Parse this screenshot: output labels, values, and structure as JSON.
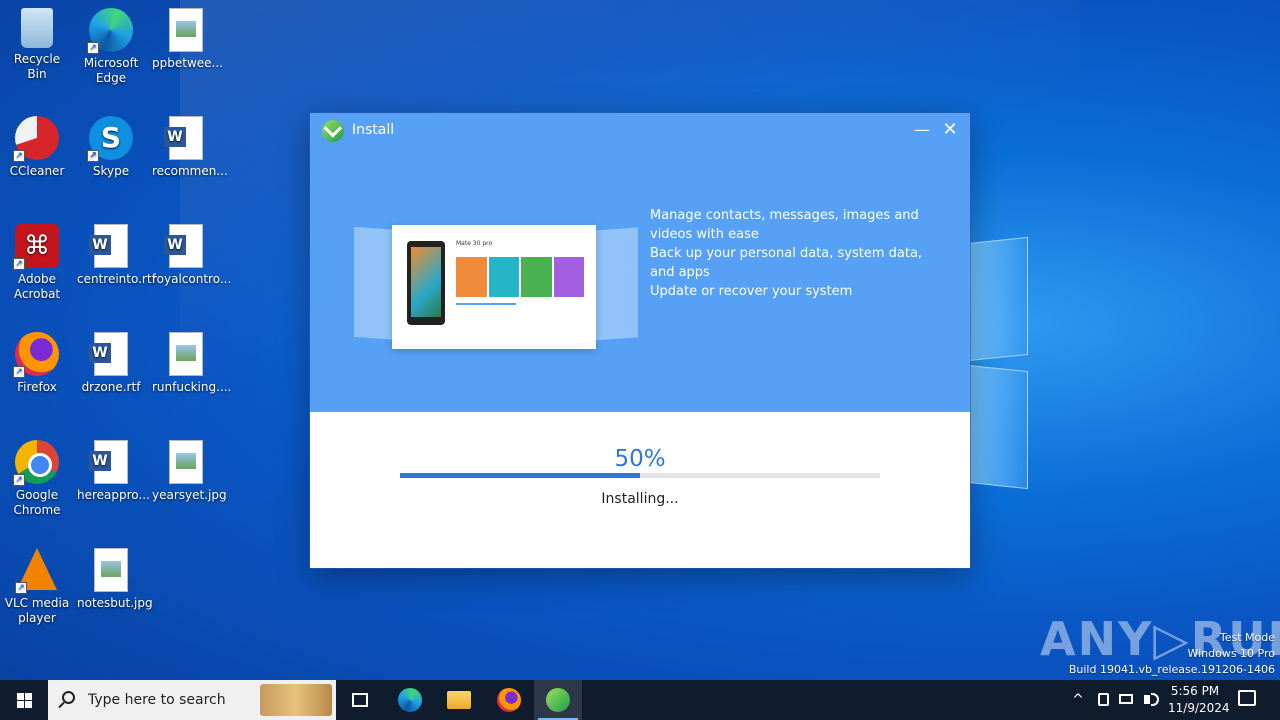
{
  "desktop": {
    "icons": [
      {
        "label": "Recycle Bin"
      },
      {
        "label": "Microsoft Edge"
      },
      {
        "label": "ppbetwee..."
      },
      {
        "label": "CCleaner"
      },
      {
        "label": "Skype"
      },
      {
        "label": "recommen..."
      },
      {
        "label": "Adobe Acrobat"
      },
      {
        "label": "centreinto.rtf"
      },
      {
        "label": "royalcontro..."
      },
      {
        "label": "Firefox"
      },
      {
        "label": "drzone.rtf"
      },
      {
        "label": "runfucking...."
      },
      {
        "label": "Google Chrome"
      },
      {
        "label": "hereappro..."
      },
      {
        "label": "yearsyet.jpg"
      },
      {
        "label": "VLC media player"
      },
      {
        "label": "notesbut.jpg"
      }
    ]
  },
  "installer": {
    "title": "Install",
    "minimize_glyph": "—",
    "close_glyph": "✕",
    "preview": {
      "device_title": "Mate 30 pro"
    },
    "features": [
      "Manage contacts, messages, images and videos with ease",
      "Back up your personal data, system data, and apps",
      "Update or recover your system"
    ],
    "progress": {
      "percent_label": "50%",
      "value": 0.5,
      "status": "Installing..."
    }
  },
  "watermark": {
    "brand": "ANY▷RUN",
    "mode": "Test Mode",
    "edition": "Windows 10 Pro",
    "build": "Build 19041.vb_release.191206-1406"
  },
  "taskbar": {
    "search_placeholder": "Type here to search",
    "apps": [
      "task-view",
      "edge",
      "file-explorer",
      "firefox",
      "hisuite-installer"
    ],
    "tray": {
      "chevron": "^",
      "time": "5:56 PM",
      "date": "11/9/2024"
    }
  },
  "colors": {
    "window_header": "#56a1f5",
    "progress_fill": "#2e78d8",
    "taskbar": "#0f1c2e"
  }
}
